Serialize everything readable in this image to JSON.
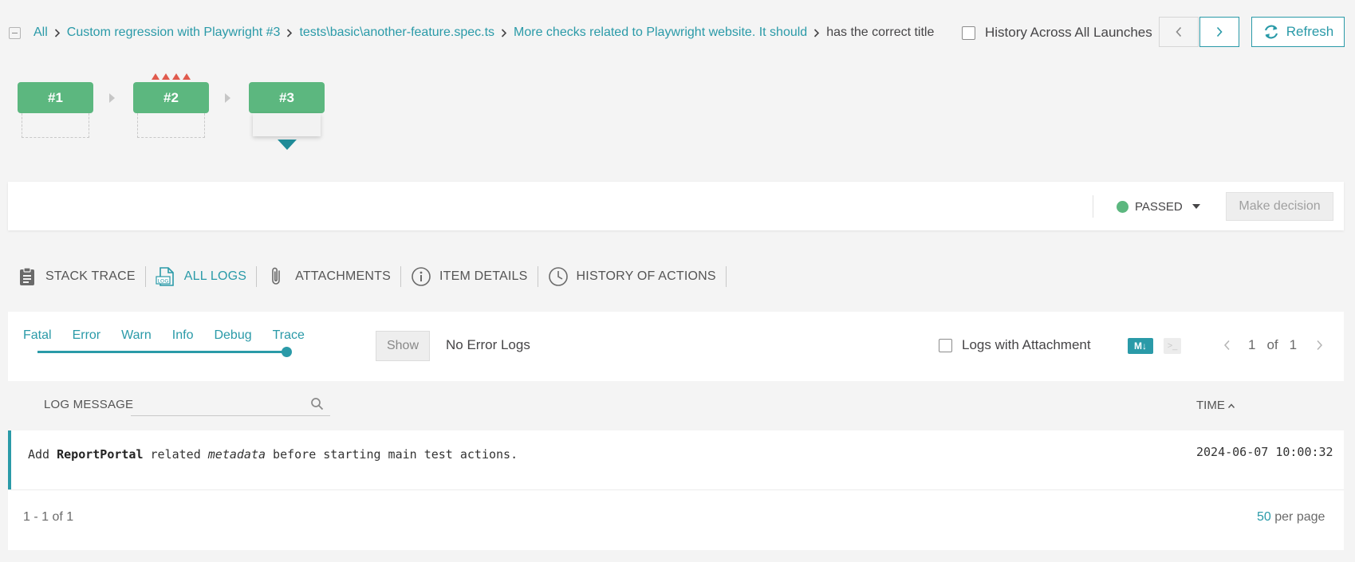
{
  "breadcrumb": {
    "items": [
      {
        "label": "All"
      },
      {
        "label": "Custom regression with Playwright #3"
      },
      {
        "label": "tests\\basic\\another-feature.spec.ts"
      },
      {
        "label": "More checks related to Playwright website. It should"
      },
      {
        "label": "has the correct title"
      }
    ]
  },
  "history_toggle": {
    "label": "History Across All Launches",
    "checked": false
  },
  "toolbar": {
    "refresh_label": "Refresh"
  },
  "launches": [
    {
      "label": "#1"
    },
    {
      "label": "#2"
    },
    {
      "label": "#3"
    }
  ],
  "decision": {
    "status": "PASSED",
    "status_color": "#5cb77f",
    "make_decision_label": "Make decision"
  },
  "tabs": [
    {
      "label": "STACK TRACE",
      "icon": "clipboard-icon"
    },
    {
      "label": "ALL LOGS",
      "icon": "log-file-icon",
      "active": true
    },
    {
      "label": "ATTACHMENTS",
      "icon": "paperclip-icon"
    },
    {
      "label": "ITEM DETAILS",
      "icon": "info-icon"
    },
    {
      "label": "HISTORY OF ACTIONS",
      "icon": "clock-icon"
    }
  ],
  "filters": {
    "levels": [
      "Fatal",
      "Error",
      "Warn",
      "Info",
      "Debug",
      "Trace"
    ],
    "selected_level": "Trace",
    "show_label": "Show",
    "error_logs_label": "No Error Logs",
    "with_attachment_label": "Logs with Attachment",
    "md_label": "M↓",
    "console_label": ">_"
  },
  "pagination": {
    "current": "1",
    "of": "of",
    "total": "1"
  },
  "table": {
    "log_message_header": "LOG MESSAGE",
    "time_header": "TIME",
    "search_placeholder": "",
    "rows": [
      {
        "message_parts": [
          "Add ",
          "ReportPortal",
          " related ",
          "metadata",
          " before starting main test actions."
        ],
        "time": "2024-06-07 10:00:32"
      }
    ]
  },
  "footer": {
    "range": "1 - 1 of 1",
    "per_page_count": "50",
    "per_page_label": " per page"
  },
  "colors": {
    "accent": "#2a9aa8",
    "passed": "#5cb77f",
    "failed_marker": "#e05a4d"
  }
}
